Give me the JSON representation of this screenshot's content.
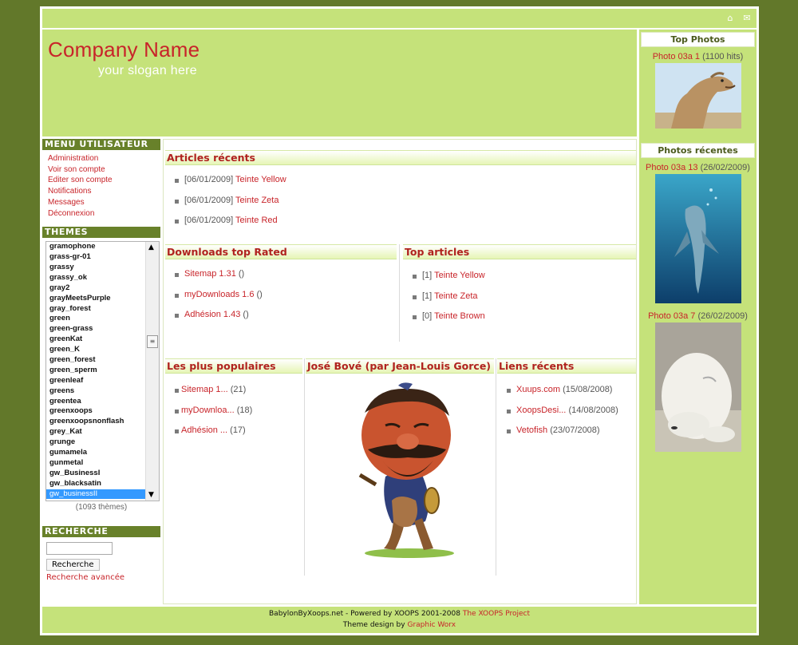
{
  "header": {
    "company": "Company Name",
    "slogan": "your slogan here"
  },
  "topbar": {
    "icons": [
      "home-icon",
      "mail-icon"
    ]
  },
  "left": {
    "user_menu_title": "MENU UTILISATEUR",
    "user_menu": [
      "Administration",
      "Voir son compte",
      "Editer son compte",
      "Notifications",
      "Messages",
      "Déconnexion"
    ],
    "themes_title": "THEMES",
    "themes": [
      "gramophone",
      "grass-gr-01",
      "grassy",
      "grassy_ok",
      "gray2",
      "grayMeetsPurple",
      "gray_forest",
      "green",
      "green-grass",
      "greenKat",
      "green_K",
      "green_forest",
      "green_sperm",
      "greenleaf",
      "greens",
      "greentea",
      "greenxoops",
      "greenxoopsnonflash",
      "grey_Kat",
      "grunge",
      "gumamela",
      "gunmetal",
      "gw_BusinessI",
      "gw_blacksatin",
      "gw_businessII"
    ],
    "selected_theme": "gw_businessII",
    "theme_count": "(1093 thèmes)",
    "search_title": "RECHERCHE",
    "search_button": "Recherche",
    "advanced_search": "Recherche avancée"
  },
  "center": {
    "recent_articles": {
      "title": "Articles récents",
      "items": [
        {
          "date": "[06/01/2009]",
          "link": "Teinte Yellow"
        },
        {
          "date": "[06/01/2009]",
          "link": "Teinte Zeta"
        },
        {
          "date": "[06/01/2009]",
          "link": "Teinte Red"
        }
      ]
    },
    "downloads": {
      "title": "Downloads top Rated",
      "items": [
        {
          "link": "Sitemap 1.31",
          "meta": "()"
        },
        {
          "link": "myDownloads 1.6",
          "meta": "()"
        },
        {
          "link": "Adhésion 1.43",
          "meta": "()"
        }
      ]
    },
    "top_articles": {
      "title": "Top articles",
      "items": [
        {
          "meta": "[1]",
          "link": "Teinte Yellow"
        },
        {
          "meta": "[1]",
          "link": "Teinte Zeta"
        },
        {
          "meta": "[0]",
          "link": "Teinte Brown"
        }
      ]
    },
    "popular": {
      "title": "Les plus populaires",
      "items": [
        {
          "link": "Sitemap 1...",
          "meta": "(21)"
        },
        {
          "link": "myDownloa...",
          "meta": "(18)"
        },
        {
          "link": "Adhésion ...",
          "meta": "(17)"
        }
      ]
    },
    "bove": {
      "title": "José Bové (par Jean-Louis Gorce)"
    },
    "recent_links": {
      "title": "Liens récents",
      "items": [
        {
          "link": "Xuups.com",
          "meta": "(15/08/2008)"
        },
        {
          "link": "XoopsDesi...",
          "meta": "(14/08/2008)"
        },
        {
          "link": "Vetofish",
          "meta": "(23/07/2008)"
        }
      ]
    }
  },
  "right": {
    "top_photos_title": "Top Photos",
    "top_photo": {
      "name": "Photo 03a 1",
      "meta": "(1100 hits)"
    },
    "recent_photos_title": "Photos récentes",
    "recent_photos": [
      {
        "name": "Photo 03a 13",
        "meta": "(26/02/2009)"
      },
      {
        "name": "Photo 03a 7",
        "meta": "(26/02/2009)"
      }
    ]
  },
  "footer": {
    "line1": "BabylonByXoops.net - Powered by XOOPS 2001-2008",
    "line1_link": "The XOOPS Project",
    "line2": "Theme design by",
    "line2_link": "Graphic Worx"
  },
  "colors": {
    "outer": "#62782a",
    "lime": "#c5e27a",
    "accent_red": "#c8242a",
    "block_title": "#68812a"
  }
}
